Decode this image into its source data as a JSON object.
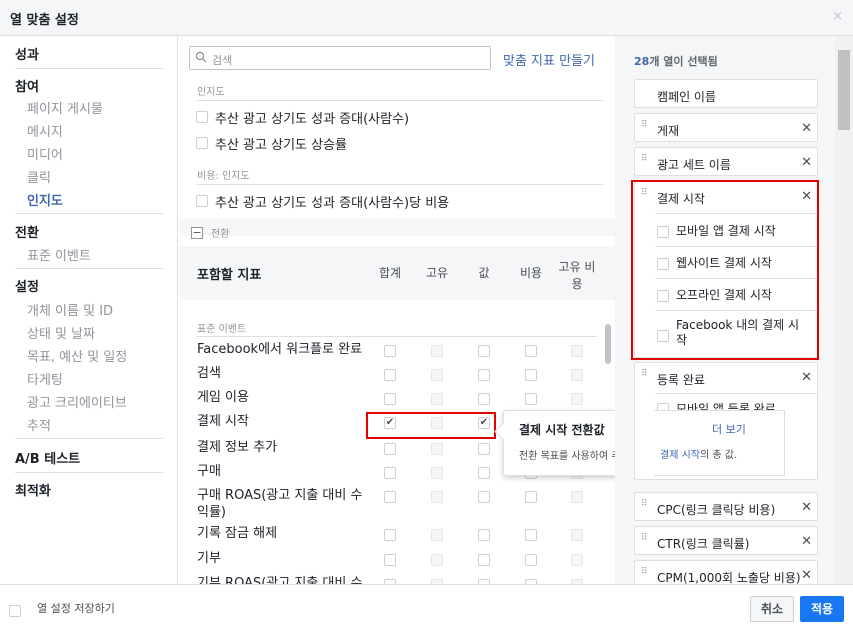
{
  "dialog": {
    "title": "열 맞춤 설정",
    "close": "×"
  },
  "sidebar": {
    "sections": [
      {
        "title": "성과",
        "items": []
      },
      {
        "title": "참여",
        "items": [
          "페이지 게시물",
          "메시지",
          "미디어",
          "클릭",
          "인지도"
        ]
      },
      {
        "title": "전환",
        "items": [
          "표준 이벤트"
        ]
      },
      {
        "title": "설정",
        "items": [
          "개체 이름 및 ID",
          "상태 및 날짜",
          "목표, 예산 및 일정",
          "타게팅",
          "광고 크리에이티브",
          "추적"
        ]
      },
      {
        "title": "A/B 테스트",
        "items": []
      },
      {
        "title": "최적화",
        "items": []
      }
    ],
    "active_item": "인지도"
  },
  "search": {
    "placeholder": "검색",
    "create_link": "맞춤 지표 만들기"
  },
  "metrics": {
    "awareness_label": "인지도",
    "awareness_items": [
      "추산 광고 상기도 성과 증대(사람수)",
      "추산 광고 상기도 상승률"
    ],
    "cost_label": "비용: 인지도",
    "cost_items": [
      "추산 광고 상기도 성과 증대(사람수)당 비용"
    ],
    "conversion_label": "전환",
    "table_title": "포함할 지표",
    "columns": [
      "합계",
      "고유",
      "값",
      "비용",
      "고유 비용"
    ],
    "std_events_label": "표준 이벤트",
    "rows": [
      "Facebook에서 워크플로 완료",
      "검색",
      "게임 이용",
      "결제 시작",
      "결제 정보 추가",
      "구매",
      "구매 ROAS(광고 지출 대비 수익률)",
      "기록 잠금 해제",
      "기부",
      "기부 ROAS(광고 지출 대비 수"
    ],
    "checked_row": "결제 시작"
  },
  "tooltip": {
    "title": "결제 시작 전환값",
    "more": "더 보기",
    "body_prefix": "전환 목표를 사용하여 추적한 ",
    "body_link": "결제 시작",
    "body_suffix": "의 총 값."
  },
  "selected": {
    "count": "28개 열이 선택됨",
    "count_num": "28",
    "count_rest": "개 열이 선택됨",
    "items": [
      {
        "label": "캠페인 이름"
      },
      {
        "label": "게재"
      },
      {
        "label": "광고 세트 이름"
      },
      {
        "label": "결제 시작",
        "sub": [
          "모바일 앱 결제 시작",
          "웹사이트 결제 시작",
          "오프라인 결제 시작",
          "Facebook 내의 결제 시작"
        ]
      },
      {
        "label": "등록 완료",
        "sub": [
          "모바일 앱 등록 완료"
        ]
      },
      {
        "label": "CPC(링크 클릭당 비용)"
      },
      {
        "label": "CTR(링크 클릭률)"
      },
      {
        "label": "CPM(1,000회 노출당 비용)"
      }
    ]
  },
  "footer": {
    "save_label": "열 설정 저장하기",
    "cancel": "취소",
    "apply": "적용"
  },
  "colors": {
    "accent": "#4267b2",
    "highlight": "#e20000",
    "apply_bg": "#1877f2"
  }
}
